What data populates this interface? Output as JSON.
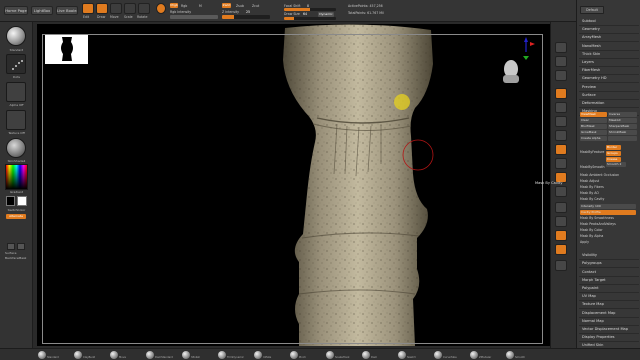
{
  "topbar": {
    "home_page": "Home Page",
    "lightbox": "LightBox",
    "live_boolean": "Live Boolean",
    "tools": [
      {
        "label": "Edit",
        "active": true
      },
      {
        "label": "Draw",
        "active": true
      },
      {
        "label": "Move",
        "active": false
      },
      {
        "label": "Scale",
        "active": false
      },
      {
        "label": "Rotate",
        "active": false
      }
    ],
    "mrgb": "Mrgb",
    "rgb": "Rgb",
    "m": "M",
    "rgb_intensity_label": "Rgb Intensity",
    "zadd": "Zadd",
    "zsub": "Zsub",
    "zcut": "Zcut",
    "z_intensity_label": "Z Intensity",
    "z_intensity_value": "25",
    "focal_shift_label": "Focal Shift",
    "focal_shift_value": "0",
    "draw_size_label": "Draw Size",
    "draw_size_value": "64",
    "dynamic": "Dynamic",
    "active_points": "ActivePoints: 457,256",
    "total_points": "TotalPoints: 61.767 Mil"
  },
  "left_shelf": {
    "brush_label": "Standard",
    "stroke_label": "Dots",
    "alpha_label": "Alpha Off",
    "texture_label": "Texture Off",
    "material_label": "SkinShade4",
    "gradient_label": "Gradient",
    "switch_color": "SwitchColor",
    "alternate": "Alternate",
    "surface": "Surface",
    "backface_mask": "BackfaceMask"
  },
  "right_shelf": {
    "buttons": [
      "BPR",
      "SPix 3",
      "Scroll",
      "Zoom",
      "Actual",
      "AAHalf",
      "Persp",
      "Floor",
      "Local",
      "L.Sym",
      "Gxyz",
      "Frame",
      "Move",
      "Scale",
      "Rotate",
      "Line Fill",
      "PolyF",
      "Transp",
      "Ghost",
      "Solo",
      "Xpose"
    ]
  },
  "right_panel": {
    "top_buttons": [
      "Default"
    ],
    "menu_top": [
      "Subtool",
      "Geometry",
      "ArrayMesh",
      "NanoMesh",
      "Thick Skin",
      "Layers",
      "FiberMesh",
      "Geometry HD",
      "Preview",
      "Surface",
      "Deformation",
      "Masking"
    ],
    "masking_rows": [
      {
        "label": "ViewMask",
        "value": "Inverse"
      },
      {
        "label": "Clear",
        "value": "MaskAll"
      },
      {
        "label": "BlurMask",
        "value": "SharpenMask"
      },
      {
        "label": "GrowMask",
        "value": "ShrinkMask"
      },
      {
        "label": "Create Alpha",
        "value": ""
      }
    ],
    "mask_by_feature": "MaskByFeature",
    "feature_opts": [
      "Border",
      "Groups",
      "Crease"
    ],
    "mask_by_smooth": "MaskBySmooth",
    "smooth_value": "Smooth 2",
    "mask_menu": [
      "Mask Ambient Occlusion",
      "Mask Adjust",
      "Mask By Fibers",
      "Mask By AO",
      "Mask By Cavity",
      "Intensity 100",
      "Cavity Profile",
      "Mask By Smoothness",
      "Mask PeaksAndValleys",
      "Mask By Color",
      "Mask By Alpha",
      "Apply"
    ],
    "menu_bottom": [
      "Visibility",
      "Polygroups",
      "Contact",
      "Morph Target",
      "Polypaint",
      "UV Map",
      "Texture Map",
      "Displacement Map",
      "Normal Map",
      "Vector Displacement Map",
      "Display Properties",
      "Unified Skin"
    ]
  },
  "tooltip": "Mask By Cavity",
  "bottom_brushes": [
    "Standard",
    "ClayBuild",
    "Move",
    "DamStandard",
    "hPolish",
    "TrimDynamic",
    "Inflate",
    "Pinch",
    "SnakeHook",
    "Dam",
    "Slash3",
    "CurveTube",
    "ZModeler",
    "Smooth"
  ],
  "colors": {
    "accent": "#e07b1f",
    "panel": "#373737",
    "canvas": "#000000"
  }
}
